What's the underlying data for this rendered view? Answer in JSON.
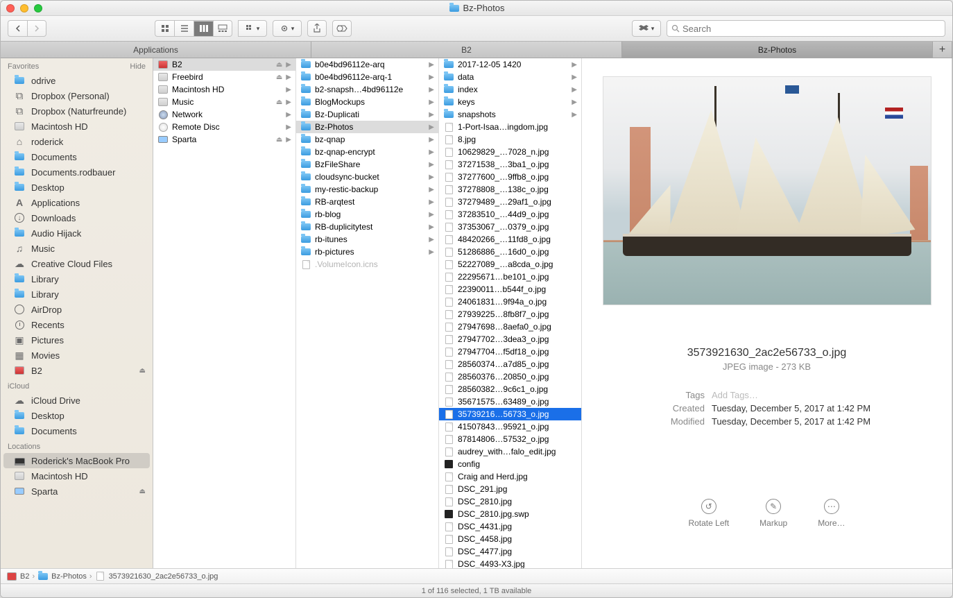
{
  "window": {
    "title": "Bz-Photos"
  },
  "search": {
    "placeholder": "Search"
  },
  "tabs": [
    {
      "label": "Applications",
      "active": false
    },
    {
      "label": "B2",
      "active": false
    },
    {
      "label": "Bz-Photos",
      "active": true
    }
  ],
  "sidebar": {
    "favorites": {
      "header": "Favorites",
      "hide": "Hide",
      "items": [
        {
          "label": "odrive",
          "icon": "folder"
        },
        {
          "label": "Dropbox (Personal)",
          "icon": "dropbox"
        },
        {
          "label": "Dropbox (Naturfreunde)",
          "icon": "dropbox"
        },
        {
          "label": "Macintosh HD",
          "icon": "hd"
        },
        {
          "label": "roderick",
          "icon": "home"
        },
        {
          "label": "Documents",
          "icon": "folder"
        },
        {
          "label": "Documents.rodbauer",
          "icon": "folder"
        },
        {
          "label": "Desktop",
          "icon": "folder"
        },
        {
          "label": "Applications",
          "icon": "apps"
        },
        {
          "label": "Downloads",
          "icon": "downloads"
        },
        {
          "label": "Audio Hijack",
          "icon": "folder"
        },
        {
          "label": "Music",
          "icon": "music"
        },
        {
          "label": "Creative Cloud Files",
          "icon": "cloud"
        },
        {
          "label": "Library",
          "icon": "folder"
        },
        {
          "label": "Library",
          "icon": "folder"
        },
        {
          "label": "AirDrop",
          "icon": "airdrop"
        },
        {
          "label": "Recents",
          "icon": "recents"
        },
        {
          "label": "Pictures",
          "icon": "pictures"
        },
        {
          "label": "Movies",
          "icon": "movies"
        },
        {
          "label": "B2",
          "icon": "b2",
          "eject": true
        }
      ]
    },
    "icloud": {
      "header": "iCloud",
      "items": [
        {
          "label": "iCloud Drive",
          "icon": "cloud"
        },
        {
          "label": "Desktop",
          "icon": "folder"
        },
        {
          "label": "Documents",
          "icon": "folder"
        }
      ]
    },
    "locations": {
      "header": "Locations",
      "items": [
        {
          "label": "Roderick's MacBook Pro",
          "icon": "laptop",
          "selected": true
        },
        {
          "label": "Macintosh HD",
          "icon": "hd"
        },
        {
          "label": "Sparta",
          "icon": "display",
          "eject": true
        }
      ]
    }
  },
  "col1": [
    {
      "name": "B2",
      "icon": "b2",
      "arrow": true,
      "eject": true,
      "sel": true
    },
    {
      "name": "Freebird",
      "icon": "hd",
      "arrow": true,
      "eject": true
    },
    {
      "name": "Macintosh HD",
      "icon": "hd",
      "arrow": true
    },
    {
      "name": "Music",
      "icon": "hd",
      "arrow": true,
      "eject": true
    },
    {
      "name": "Network",
      "icon": "globe",
      "arrow": true
    },
    {
      "name": "Remote Disc",
      "icon": "disc",
      "arrow": true
    },
    {
      "name": "Sparta",
      "icon": "display",
      "arrow": true,
      "eject": true
    }
  ],
  "col2": [
    {
      "name": "b0e4bd96112e-arq",
      "icon": "folder",
      "arrow": true
    },
    {
      "name": "b0e4bd96112e-arq-1",
      "icon": "folder",
      "arrow": true
    },
    {
      "name": "b2-snapsh…4bd96112e",
      "icon": "folder",
      "arrow": true
    },
    {
      "name": "BlogMockups",
      "icon": "folder",
      "arrow": true
    },
    {
      "name": "Bz-Duplicati",
      "icon": "folder",
      "arrow": true
    },
    {
      "name": "Bz-Photos",
      "icon": "folder",
      "arrow": true,
      "sel": true
    },
    {
      "name": "bz-qnap",
      "icon": "folder",
      "arrow": true
    },
    {
      "name": "bz-qnap-encrypt",
      "icon": "folder",
      "arrow": true
    },
    {
      "name": "BzFileShare",
      "icon": "folder",
      "arrow": true
    },
    {
      "name": "cloudsync-bucket",
      "icon": "folder",
      "arrow": true
    },
    {
      "name": "my-restic-backup",
      "icon": "folder",
      "arrow": true
    },
    {
      "name": "RB-arqtest",
      "icon": "folder",
      "arrow": true
    },
    {
      "name": "rb-blog",
      "icon": "folder",
      "arrow": true
    },
    {
      "name": "RB-duplicitytest",
      "icon": "folder",
      "arrow": true
    },
    {
      "name": "rb-itunes",
      "icon": "folder",
      "arrow": true
    },
    {
      "name": "rb-pictures",
      "icon": "folder",
      "arrow": true
    },
    {
      "name": ".VolumeIcon.icns",
      "icon": "doc",
      "dim": true
    }
  ],
  "col3": [
    {
      "name": "2017-12-05 1420",
      "icon": "folder",
      "arrow": true
    },
    {
      "name": "data",
      "icon": "folder",
      "arrow": true
    },
    {
      "name": "index",
      "icon": "folder",
      "arrow": true
    },
    {
      "name": "keys",
      "icon": "folder",
      "arrow": true
    },
    {
      "name": "snapshots",
      "icon": "folder",
      "arrow": true
    },
    {
      "name": "1-Port-Isaa…ingdom.jpg",
      "icon": "doc"
    },
    {
      "name": "8.jpg",
      "icon": "doc"
    },
    {
      "name": "10629829_…7028_n.jpg",
      "icon": "doc"
    },
    {
      "name": "37271538_…3ba1_o.jpg",
      "icon": "doc"
    },
    {
      "name": "37277600_…9ffb8_o.jpg",
      "icon": "doc"
    },
    {
      "name": "37278808_…138c_o.jpg",
      "icon": "doc"
    },
    {
      "name": "37279489_…29af1_o.jpg",
      "icon": "doc"
    },
    {
      "name": "37283510_…44d9_o.jpg",
      "icon": "doc"
    },
    {
      "name": "37353067_…0379_o.jpg",
      "icon": "doc"
    },
    {
      "name": "48420266_…11fd8_o.jpg",
      "icon": "doc"
    },
    {
      "name": "51286886_…16d0_o.jpg",
      "icon": "doc"
    },
    {
      "name": "52227089_…a8cda_o.jpg",
      "icon": "doc"
    },
    {
      "name": "22295671…be101_o.jpg",
      "icon": "doc"
    },
    {
      "name": "22390011…b544f_o.jpg",
      "icon": "doc"
    },
    {
      "name": "24061831…9f94a_o.jpg",
      "icon": "doc"
    },
    {
      "name": "27939225…8fb8f7_o.jpg",
      "icon": "doc"
    },
    {
      "name": "27947698…8aefa0_o.jpg",
      "icon": "doc"
    },
    {
      "name": "27947702…3dea3_o.jpg",
      "icon": "doc"
    },
    {
      "name": "27947704…f5df18_o.jpg",
      "icon": "doc"
    },
    {
      "name": "28560374…a7d85_o.jpg",
      "icon": "doc"
    },
    {
      "name": "28560376…20850_o.jpg",
      "icon": "doc"
    },
    {
      "name": "28560382…9c6c1_o.jpg",
      "icon": "doc"
    },
    {
      "name": "35671575…63489_o.jpg",
      "icon": "doc"
    },
    {
      "name": "35739216…56733_o.jpg",
      "icon": "doc",
      "selblue": true
    },
    {
      "name": "41507843…95921_o.jpg",
      "icon": "doc"
    },
    {
      "name": "87814806…57532_o.jpg",
      "icon": "doc"
    },
    {
      "name": "audrey_with…falo_edit.jpg",
      "icon": "doc"
    },
    {
      "name": "config",
      "icon": "exec"
    },
    {
      "name": "Craig and Herd.jpg",
      "icon": "doc"
    },
    {
      "name": "DSC_291.jpg",
      "icon": "doc"
    },
    {
      "name": "DSC_2810.jpg",
      "icon": "doc"
    },
    {
      "name": "DSC_2810.jpg.swp",
      "icon": "exec"
    },
    {
      "name": "DSC_4431.jpg",
      "icon": "doc"
    },
    {
      "name": "DSC_4458.jpg",
      "icon": "doc"
    },
    {
      "name": "DSC_4477.jpg",
      "icon": "doc"
    },
    {
      "name": "DSC_4493-X3.jpg",
      "icon": "doc"
    }
  ],
  "preview": {
    "filename": "3573921630_2ac2e56733_o.jpg",
    "kind": "JPEG image - 273 KB",
    "tags_label": "Tags",
    "tags_placeholder": "Add Tags…",
    "created_label": "Created",
    "created": "Tuesday, December 5, 2017 at 1:42 PM",
    "modified_label": "Modified",
    "modified": "Tuesday, December 5, 2017 at 1:42 PM",
    "actions": {
      "rotate": "Rotate Left",
      "markup": "Markup",
      "more": "More…"
    }
  },
  "pathbar": {
    "p1": "B2",
    "p2": "Bz-Photos",
    "p3": "3573921630_2ac2e56733_o.jpg"
  },
  "status": "1 of 116 selected, 1 TB available"
}
